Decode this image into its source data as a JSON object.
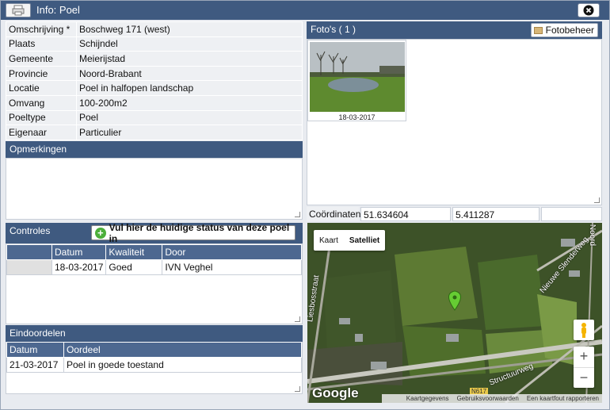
{
  "window": {
    "title": "Info: Poel"
  },
  "info": [
    {
      "label": "Omschrijving *",
      "value": "Boschweg 171 (west)"
    },
    {
      "label": "Plaats",
      "value": "Schijndel"
    },
    {
      "label": "Gemeente",
      "value": "Meierijstad"
    },
    {
      "label": "Provincie",
      "value": "Noord-Brabant"
    },
    {
      "label": "Locatie",
      "value": "Poel in halfopen landschap"
    },
    {
      "label": "Omvang",
      "value": "100-200m2"
    },
    {
      "label": "Poeltype",
      "value": "Poel"
    },
    {
      "label": "Eigenaar",
      "value": "Particulier"
    }
  ],
  "opmerkingen": {
    "heading": "Opmerkingen",
    "text": ""
  },
  "controles": {
    "heading": "Controles",
    "status_button": "Vul hier de huidige status van deze poel in",
    "columns": [
      "",
      "Datum",
      "Kwaliteit",
      "Door"
    ],
    "rows": [
      {
        "datum": "18-03-2017",
        "kwaliteit": "Goed",
        "door": "IVN Veghel"
      }
    ]
  },
  "eindoordelen": {
    "heading": "Eindoordelen",
    "columns": [
      "Datum",
      "Oordeel"
    ],
    "rows": [
      {
        "datum": "21-03-2017",
        "oordeel": "Poel in goede toestand"
      }
    ]
  },
  "fotos": {
    "heading": "Foto's ( 1 )",
    "manage_button": "Fotobeheer",
    "items": [
      {
        "caption": "18-03-2017"
      }
    ]
  },
  "coordinaten": {
    "label": "Coördinaten",
    "lat": "51.634604",
    "lon": "5.411287"
  },
  "map": {
    "tab_map": "Kaart",
    "tab_satellite": "Satelliet",
    "logo": "Google",
    "zoom_in": "+",
    "zoom_out": "−",
    "footer": [
      "Kaartgegevens",
      "Gebruiksvoorwaarden",
      "Een kaartfout rapporteren"
    ],
    "labels": [
      "Nieuwe Slenderweg",
      "Structuurweg",
      "Liesbosstraat",
      "Noord",
      "N617"
    ]
  },
  "colors": {
    "header": "#3f5a80",
    "grid_header": "#4d6890",
    "marker": "#66cc33"
  }
}
